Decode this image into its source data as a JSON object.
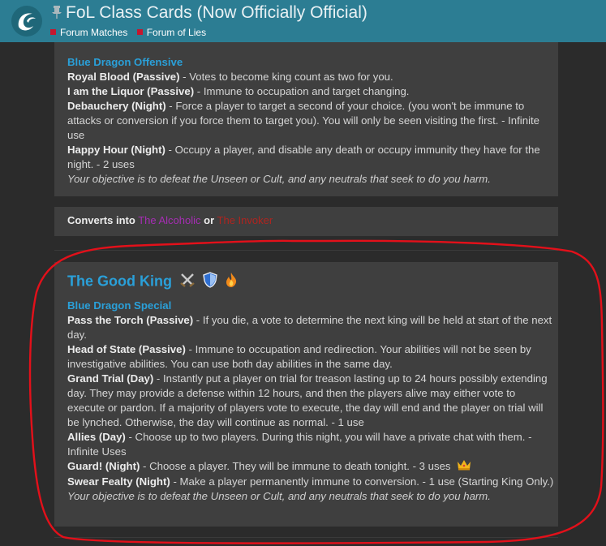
{
  "header": {
    "title": "FoL Class Cards (Now Officially Official)",
    "breadcrumbs": [
      "Forum Matches",
      "Forum of Lies"
    ]
  },
  "card_top": {
    "category": "Blue Dragon Offensive",
    "abilities": [
      {
        "name": "Royal Blood (Passive)",
        "text": " - Votes to become king count as two for you."
      },
      {
        "name": "I am the Liquor (Passive)",
        "text": " - Immune to occupation and target changing."
      },
      {
        "name": "Debauchery (Night)",
        "text": " - Force a player to target a second of your choice. (you won't be immune to attacks or conversion if you force them to target you). You will only be seen visiting the first. - Infinite use"
      },
      {
        "name": "Happy Hour (Night)",
        "text": " - Occupy a player, and disable any death or occupy immunity they have for the night. - 2 uses"
      }
    ],
    "objective": "Your objective is to defeat the Unseen or Cult, and any neutrals that seek to do you harm."
  },
  "converts": {
    "label": "Converts into",
    "option1": "The Alcoholic",
    "or": "or",
    "option2": "The Invoker"
  },
  "card_king": {
    "title": "The Good King",
    "category": "Blue Dragon Special",
    "abilities": [
      {
        "name": "Pass the Torch (Passive)",
        "text": " - If you die, a vote to determine the next king will be held at start of the next day."
      },
      {
        "name": "Head of State (Passive)",
        "text": " - Immune to occupation and redirection. Your abilities will not be seen by investigative abilities. You can use both day abilities in the same day."
      },
      {
        "name": "Grand Trial (Day)",
        "text": " - Instantly put a player on trial for treason lasting up to 24 hours possibly extending day. They may provide a defense within 12 hours, and then the players alive may either vote to execute or pardon. If a majority of players vote to execute, the day will end and the player on trial will be lynched. Otherwise, the day will continue as normal. - 1 use"
      },
      {
        "name": "Allies (Day)",
        "text": " - Choose up to two players. During this night, you will have a private chat with them. - Infinite Uses"
      },
      {
        "name": "Guard! (Night)",
        "text": " - Choose a player. They will be immune to death tonight. - 3 uses"
      },
      {
        "name": "Swear Fealty (Night)",
        "text": " - Make a player permanently immune to conversion. - 1 use (Starting King Only.)"
      }
    ],
    "objective": "Your objective is to defeat the Unseen or Cult, and any neutrals that seek to do you harm."
  },
  "colors": {
    "header": "#2c7d93",
    "accent": "#2aa0d9",
    "panel": "#3f3f3f",
    "annotation": "#e3101a"
  }
}
